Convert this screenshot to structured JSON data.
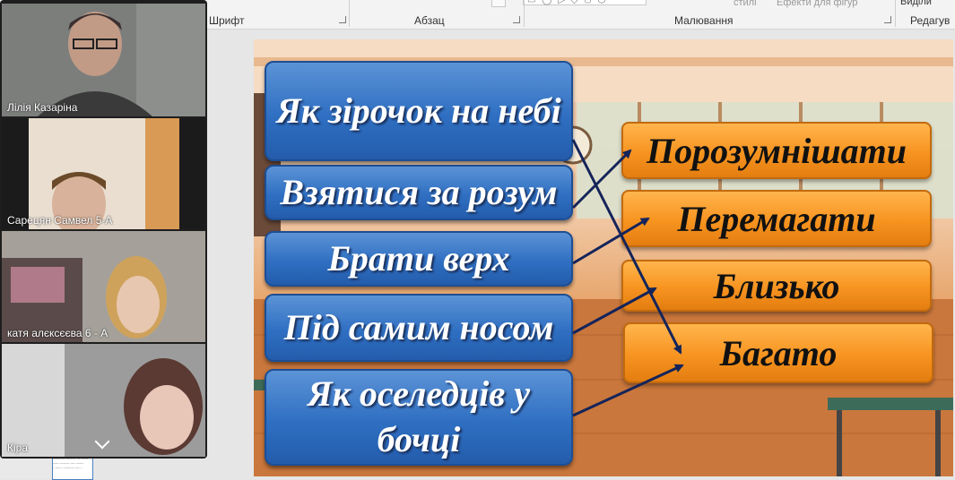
{
  "ribbon": {
    "groups": [
      "Шрифт",
      "Абзац",
      "Малювання",
      "Редагув"
    ],
    "styles_label": "стилі",
    "effects_label": "Ефекти для фігур",
    "select_label": "Виділи"
  },
  "participants": [
    {
      "name": "Лілія Казаріна"
    },
    {
      "name": "Сарецян Самвел 5-А"
    },
    {
      "name": "катя алєксєєва 6 - А"
    },
    {
      "name": "Кіра"
    }
  ],
  "slide": {
    "left_phrases": [
      "Як зірочок на небі",
      "Взятися за розум",
      "Брати верх",
      "Під самим носом",
      "Як оселедців у бочці"
    ],
    "right_words": [
      "Порозумнішати",
      "Перемагати",
      "Близько",
      "Багато"
    ]
  },
  "colors": {
    "blue_box": "#2f6fc2",
    "orange_box": "#f79420",
    "active_speaker": "#3ad18f",
    "arrow": "#14245a"
  }
}
